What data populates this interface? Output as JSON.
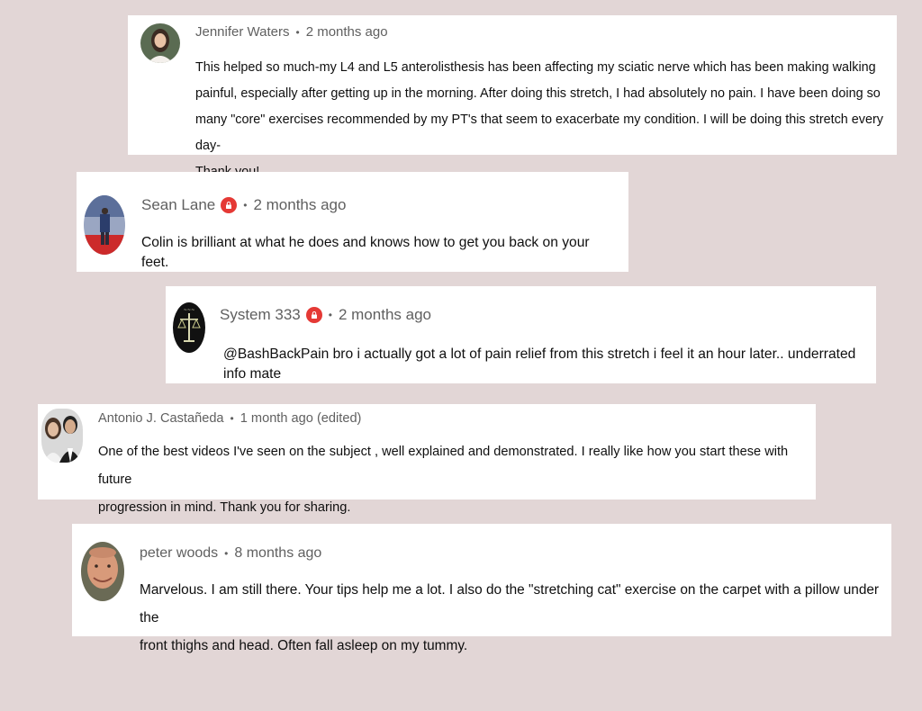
{
  "comments": [
    {
      "author": "Jennifer Waters",
      "time": "2 months ago",
      "badge": false,
      "text": "This helped so much-my L4 and L5 anterolisthesis has been affecting my sciatic nerve which has been making walking\npainful, especially after getting up in the morning. After doing this stretch,  I had absolutely no pain. I have been doing so\nmany \"core\" exercises recommended by my PT's that seem to exacerbate my condition.  I will be doing this stretch every day-\nThank you!",
      "avatar_icon": "woman-portrait-icon"
    },
    {
      "author": "Sean Lane",
      "time": "2 months ago",
      "badge": true,
      "text": "Colin is brilliant at what he does and knows how to get you back on your feet.",
      "avatar_icon": "person-on-stage-icon"
    },
    {
      "author": "System 333",
      "time": "2 months ago",
      "badge": true,
      "text": "@BashBackPain  bro i actually got a lot of pain relief from this stretch i feel it an hour later.. underrated info mate",
      "avatar_icon": "libra-scales-icon"
    },
    {
      "author": "Antonio J. Castañeda",
      "time": "1 month ago (edited)",
      "badge": false,
      "text": "One of the best videos I've seen on the subject , well explained and demonstrated. I really like how you start these with future\nprogression in mind. Thank you for sharing.",
      "avatar_icon": "couple-portrait-icon"
    },
    {
      "author": "peter woods",
      "time": "8 months ago",
      "badge": false,
      "text": "Marvelous. I am still there. Your tips help me a lot. I also do the \"stretching cat\"  exercise on the carpet with a pillow under the\nfront thighs and head. Often fall asleep on my tummy.",
      "avatar_icon": "man-portrait-icon"
    }
  ],
  "separator": "•",
  "colors": {
    "background": "#e2d6d6",
    "card": "#ffffff",
    "meta_text": "#606060",
    "body_text": "#0f0f0f",
    "badge": "#e53935"
  }
}
